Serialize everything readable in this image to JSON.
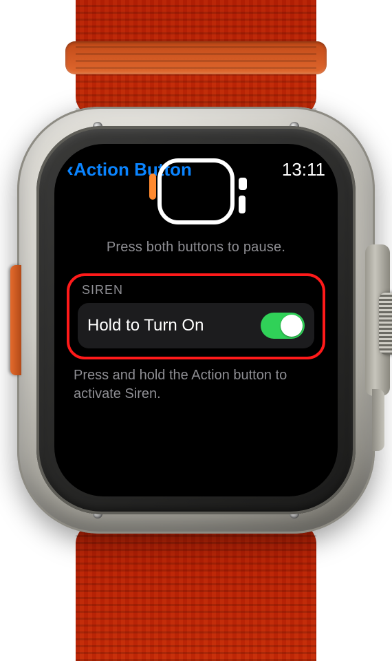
{
  "status": {
    "back_label": "Action Button",
    "time": "13:11"
  },
  "hint": "Press both buttons to pause.",
  "section": {
    "header": "SIREN",
    "row_label": "Hold to Turn On",
    "toggle_on": true
  },
  "footer": "Press and hold the Action but­ton to activate Siren."
}
